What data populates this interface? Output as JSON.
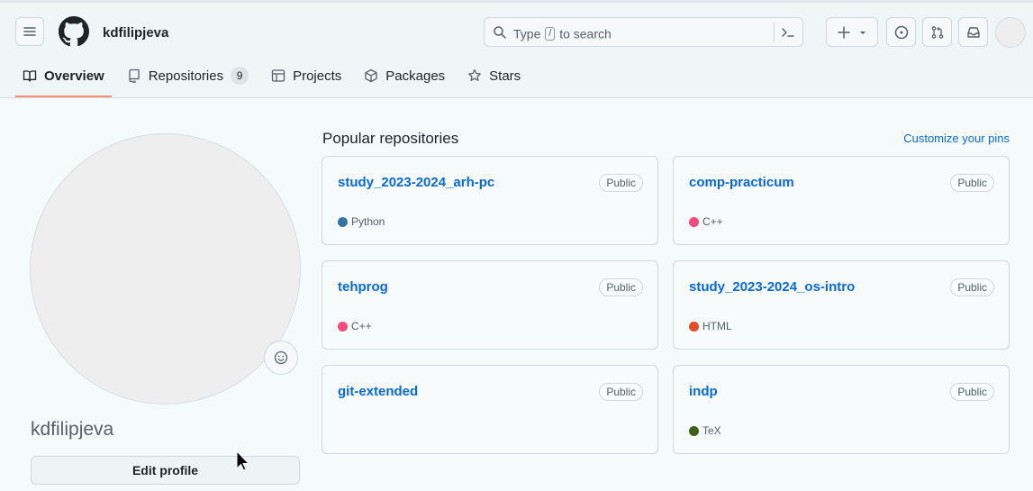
{
  "header": {
    "username": "kdfilipjeva",
    "search": {
      "prefix": "Type",
      "key": "/",
      "suffix": "to search"
    }
  },
  "tabs": [
    {
      "label": "Overview",
      "icon": "book-icon",
      "active": true
    },
    {
      "label": "Repositories",
      "icon": "repo-icon",
      "count": "9"
    },
    {
      "label": "Projects",
      "icon": "table-icon"
    },
    {
      "label": "Packages",
      "icon": "package-icon"
    },
    {
      "label": "Stars",
      "icon": "star-icon"
    }
  ],
  "profile": {
    "name": "kdfilipjeva",
    "edit_label": "Edit profile"
  },
  "popular": {
    "title": "Popular repositories",
    "customize_label": "Customize your pins",
    "repos": [
      {
        "name": "study_2023-2024_arh-pc",
        "visibility": "Public",
        "language": "Python",
        "color": "#3572A5"
      },
      {
        "name": "comp-practicum",
        "visibility": "Public",
        "language": "C++",
        "color": "#f34b7d"
      },
      {
        "name": "tehprog",
        "visibility": "Public",
        "language": "C++",
        "color": "#f34b7d"
      },
      {
        "name": "study_2023-2024_os-intro",
        "visibility": "Public",
        "language": "HTML",
        "color": "#e34c26"
      },
      {
        "name": "git-extended",
        "visibility": "Public",
        "language": "",
        "color": ""
      },
      {
        "name": "indp",
        "visibility": "Public",
        "language": "TeX",
        "color": "#3D6117"
      }
    ]
  },
  "colors": {
    "accent_link": "#0969da",
    "tab_underline": "#fd8c73"
  }
}
